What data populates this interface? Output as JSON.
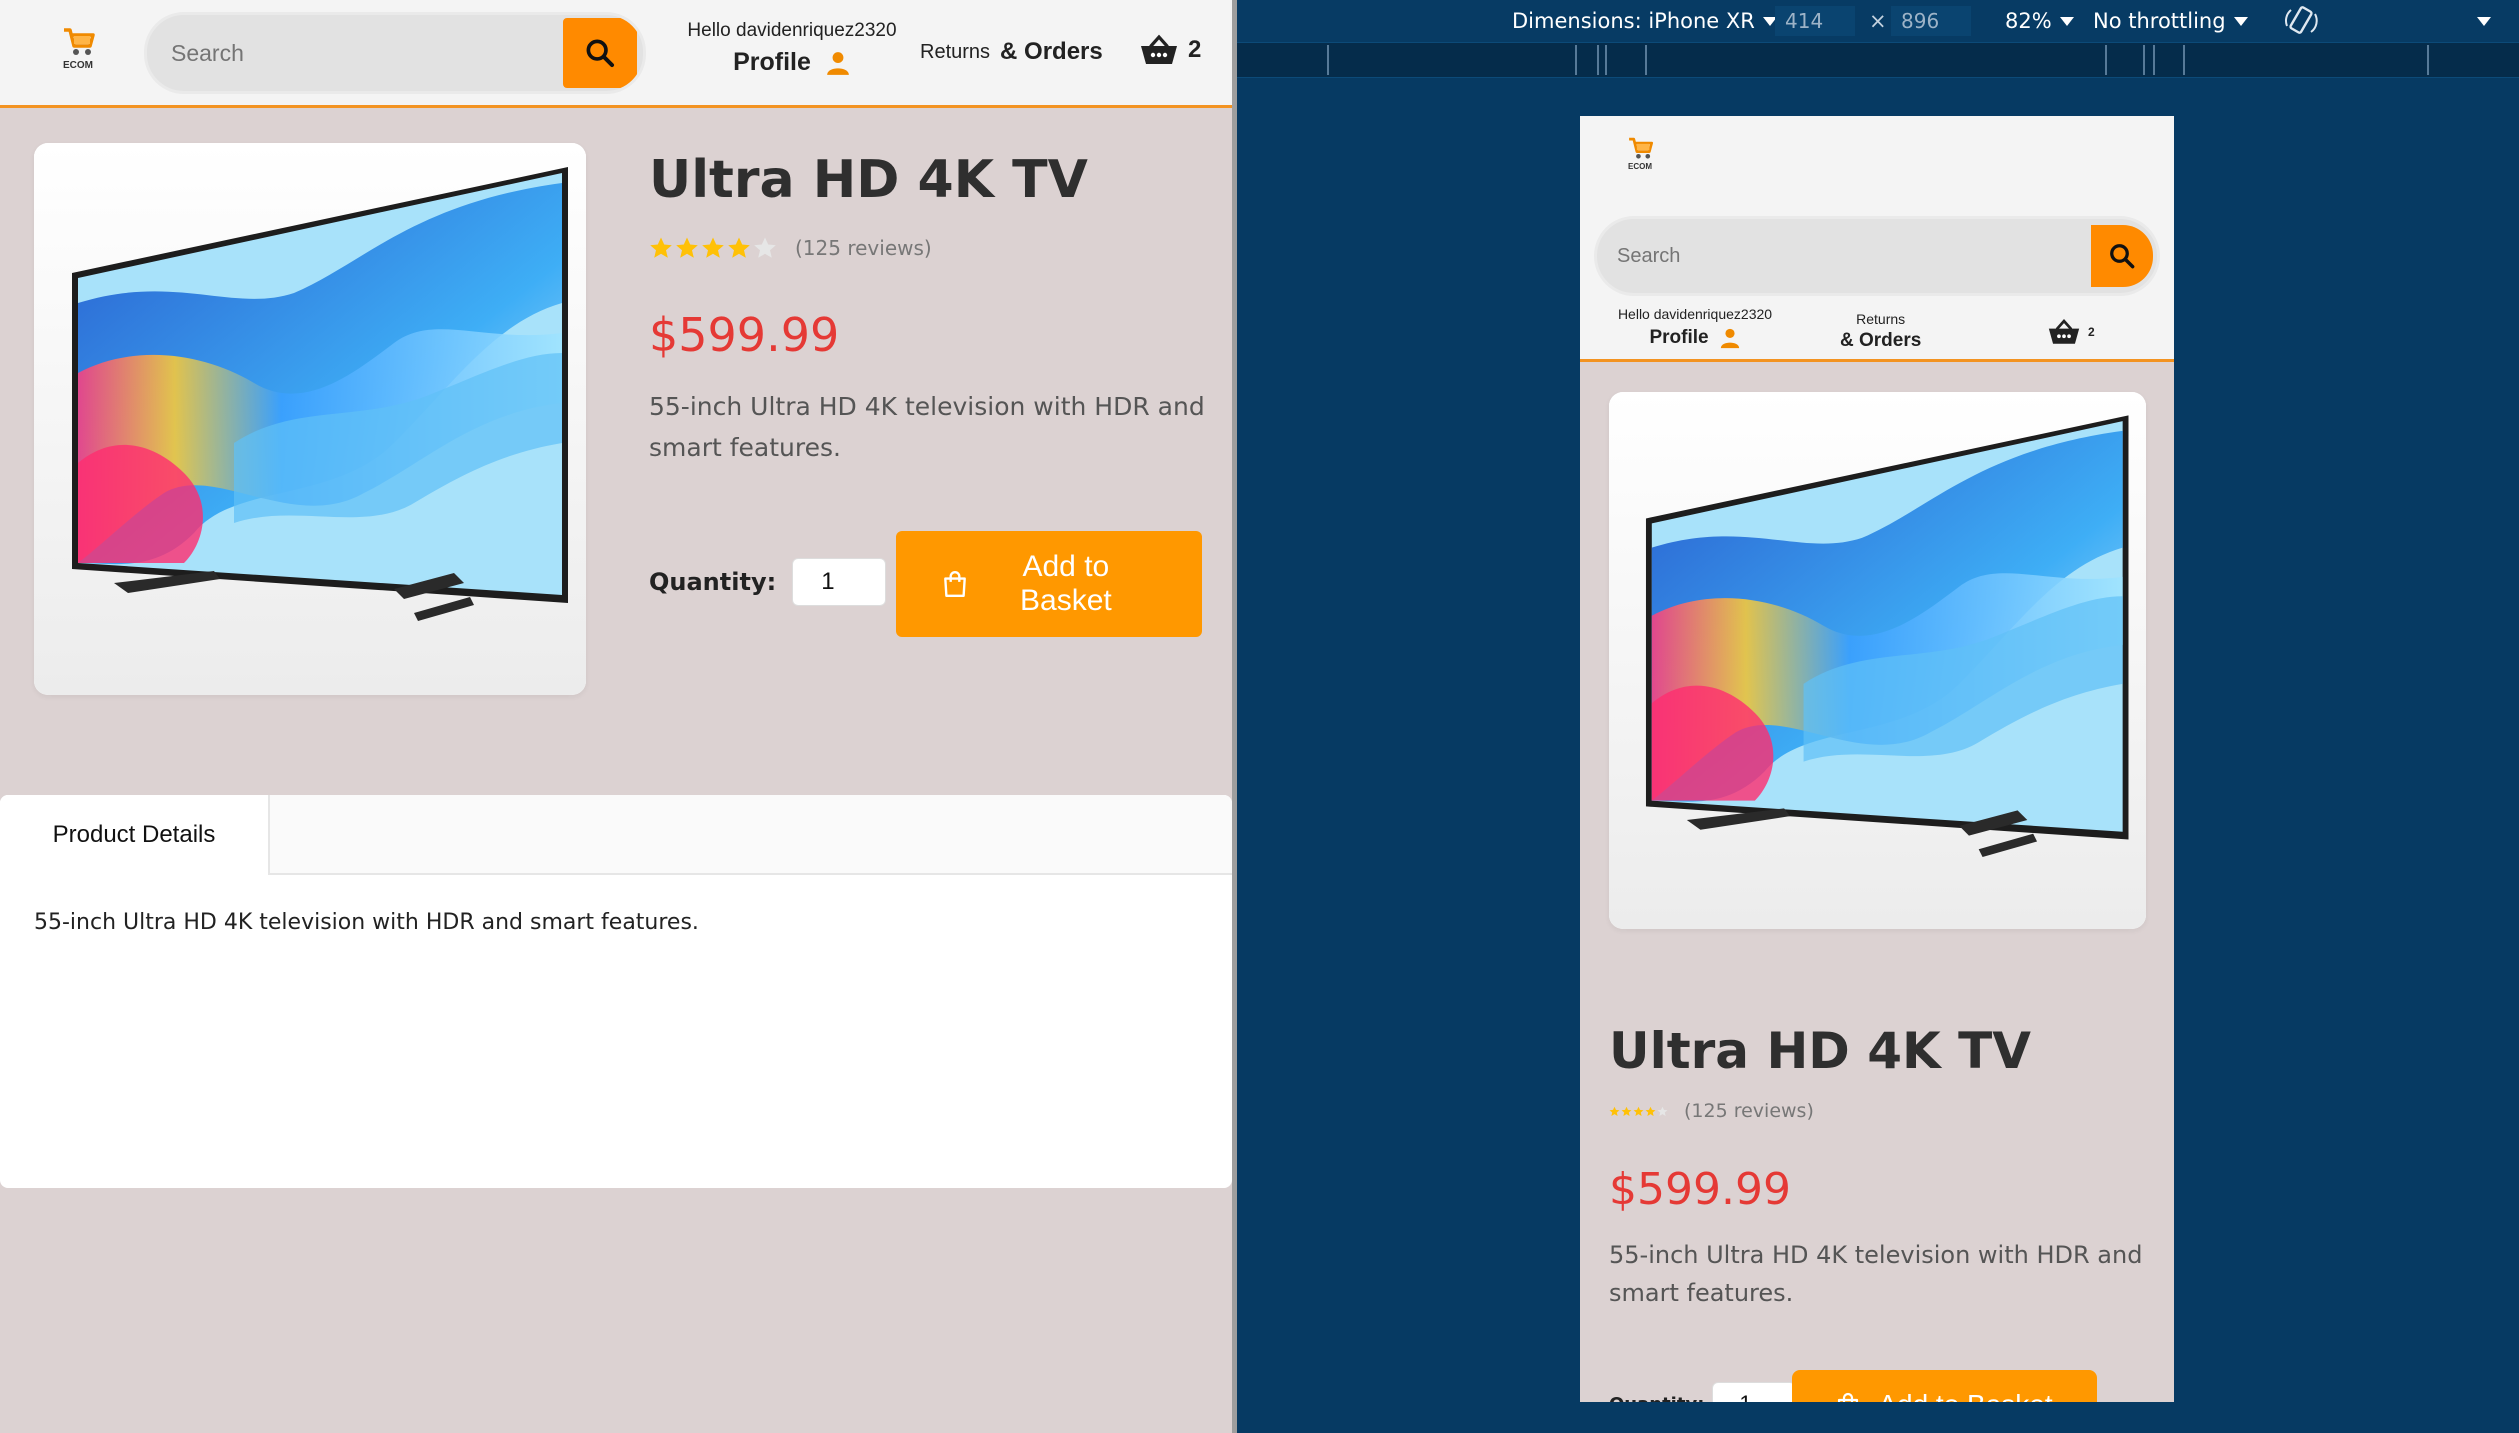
{
  "header": {
    "logo_text": "ECOM",
    "search_placeholder": "Search",
    "greeting": "Hello davidenriquez2320",
    "profile_label": "Profile",
    "returns_label": "Returns",
    "orders_label": "& Orders",
    "basket_count": "2"
  },
  "product": {
    "title": "Ultra HD 4K TV",
    "rating": 4,
    "rating_max": 5,
    "reviews": "(125 reviews)",
    "price": "$599.99",
    "description": "55-inch Ultra HD 4K television with HDR and smart features.",
    "quantity_label": "Quantity:",
    "quantity_value": "1",
    "add_to_basket_label": "Add to Basket",
    "add_line1": "Add to",
    "add_line2": "Basket"
  },
  "tabs": {
    "active_tab": "Product Details",
    "content": "55-inch Ultra HD 4K television with HDR and smart features."
  },
  "devtools": {
    "dimensions_label": "Dimensions: iPhone XR",
    "width": "414",
    "height": "896",
    "zoom": "82%",
    "throttling": "No throttling",
    "times_symbol": "×"
  },
  "phone_qty_label": "Quantity:",
  "colors": {
    "accent": "#ff8a00",
    "price": "#e53935",
    "page_bg": "#dcd2d2",
    "devtools_bg": "#063a63",
    "star": "#ffc107"
  }
}
